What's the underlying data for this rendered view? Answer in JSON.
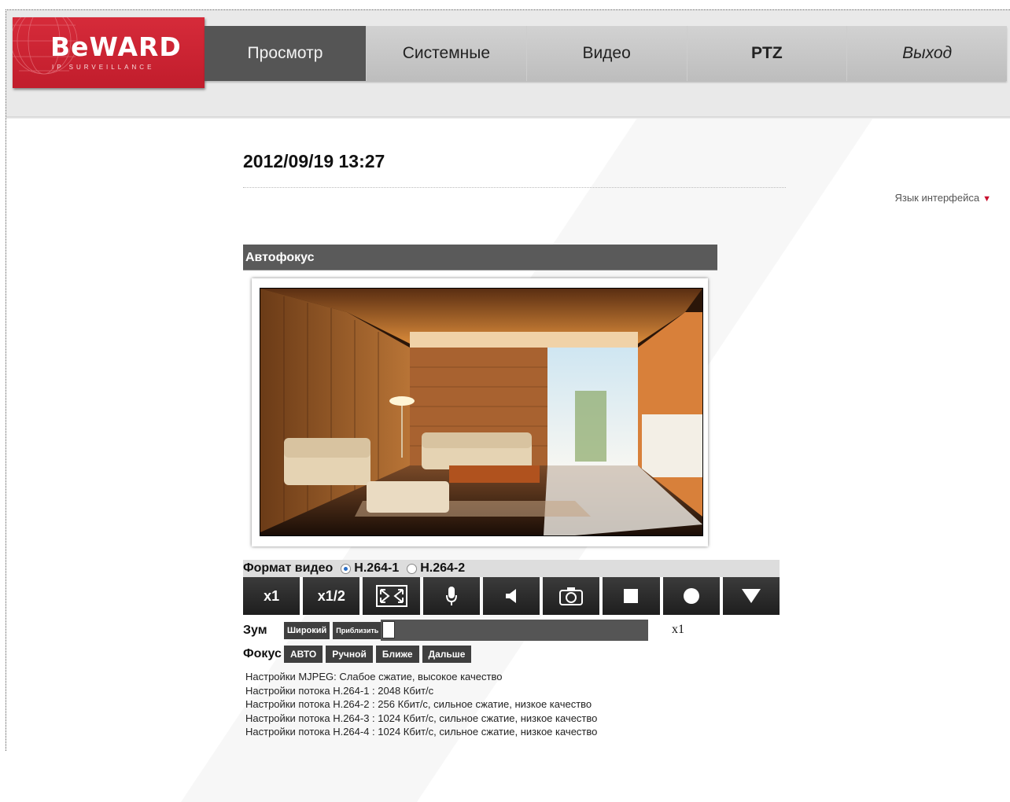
{
  "header": {
    "brand": "BeWARD",
    "brand_tag": "IP SURVEILLANCE",
    "nav": [
      {
        "label": "Просмотр",
        "active": true
      },
      {
        "label": "Системные"
      },
      {
        "label": "Видео"
      },
      {
        "label": "PTZ"
      },
      {
        "label": "Выход"
      }
    ]
  },
  "datetime": "2012/09/19 13:27",
  "language": {
    "label": "Язык интерфейса",
    "arrow": "▼"
  },
  "panel": {
    "title": "Автофокус"
  },
  "format": {
    "label": "Формат видео",
    "options": [
      {
        "label": "H.264-1",
        "selected": true
      },
      {
        "label": "H.264-2",
        "selected": false
      }
    ]
  },
  "controls": {
    "x1": "x1",
    "x12": "x1/2",
    "icons": [
      "fullscreen-icon",
      "microphone-icon",
      "speaker-icon",
      "snapshot-icon",
      "stop-icon",
      "record-icon",
      "menu-down-icon"
    ]
  },
  "zoom": {
    "label": "Зум",
    "wide": "Широкий",
    "tele": "Приблизить",
    "value": "x1",
    "level": 0.0
  },
  "focus": {
    "label": "Фокус",
    "buttons": [
      "АВТО",
      "Ручной",
      "Ближе",
      "Дальше"
    ]
  },
  "settings": [
    "Настройки MJPEG: Слабое сжатие, высокое качество",
    "Настройки потока H.264-1 : 2048 Кбит/с",
    "Настройки потока H.264-2 : 256 Кбит/с, сильное сжатие, низкое качество",
    "Настройки потока H.264-3 : 1024 Кбит/с, сильное сжатие, низкое качество",
    "Настройки потока H.264-4 : 1024 Кбит/с, сильное сжатие, низкое качество"
  ],
  "colors": {
    "brand_red": "#c11d2c",
    "nav_active": "#555555",
    "button_dark": "#2b2b2b"
  }
}
